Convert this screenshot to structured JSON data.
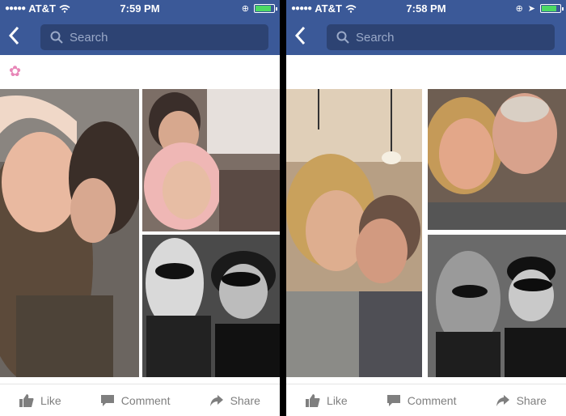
{
  "left": {
    "status": {
      "carrier": "AT&T",
      "time": "7:59 PM"
    },
    "search": {
      "placeholder": "Search"
    },
    "actions": {
      "like": "Like",
      "comment": "Comment",
      "share": "Share"
    }
  },
  "right": {
    "status": {
      "carrier": "AT&T",
      "time": "7:58 PM"
    },
    "search": {
      "placeholder": "Search"
    },
    "actions": {
      "like": "Like",
      "comment": "Comment",
      "share": "Share"
    }
  },
  "icons": [
    "back-chevron-icon",
    "search-icon",
    "wifi-icon",
    "battery-icon",
    "flower-emoji-icon",
    "like-icon",
    "comment-icon",
    "share-icon"
  ],
  "colors": {
    "facebook_blue": "#3b5998",
    "search_bg": "#2d4373",
    "action_gray": "#7f7f7f"
  }
}
